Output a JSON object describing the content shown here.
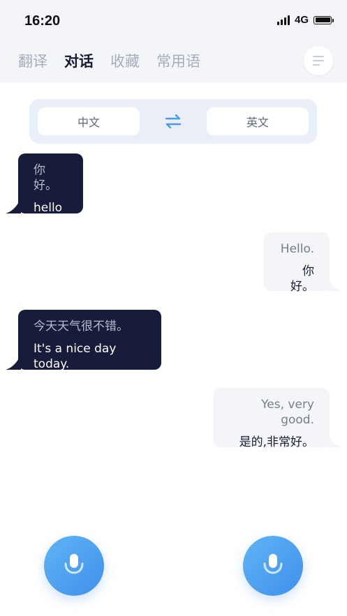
{
  "status_bar": {
    "time": "16:20",
    "network": "4G"
  },
  "tabs": [
    {
      "label": "翻译",
      "active": false
    },
    {
      "label": "对话",
      "active": true
    },
    {
      "label": "收藏",
      "active": false
    },
    {
      "label": "常用语",
      "active": false
    }
  ],
  "language_bar": {
    "source": "中文",
    "target": "英文"
  },
  "messages": [
    {
      "side": "left",
      "source_text": "你好。",
      "translated_text": "hello"
    },
    {
      "side": "right",
      "source_text": "Hello.",
      "translated_text": "你好。"
    },
    {
      "side": "left",
      "source_text": "今天天气很不错。",
      "translated_text": "It's a nice day today."
    },
    {
      "side": "right",
      "source_text": "Yes, very good.",
      "translated_text": "是的,非常好。"
    }
  ],
  "icons": {
    "menu": "menu-icon",
    "swap": "swap-arrows-icon",
    "mic": "microphone-icon",
    "signal": "signal-icon",
    "battery": "battery-icon"
  },
  "colors": {
    "accent": "#4a9cf0",
    "bubble_dark": "#171c3a",
    "bubble_light": "#f4f5f9",
    "header_bg": "#f4f5f9"
  }
}
